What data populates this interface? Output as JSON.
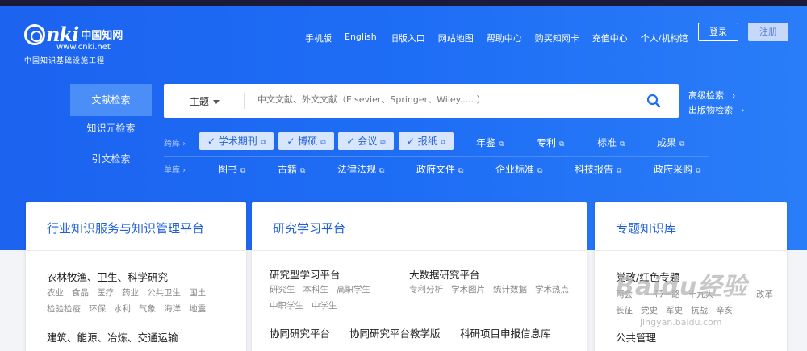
{
  "logo": {
    "nki": "nki",
    "cn": "中国知网",
    "url": "www.cnki.net",
    "subtitle": "中国知识基础设施工程"
  },
  "topnav": [
    "手机版",
    "English",
    "旧版入口",
    "网站地图",
    "帮助中心",
    "购买知网卡",
    "充值中心",
    "个人/机构馆"
  ],
  "auth": {
    "login": "登录",
    "register": "注册"
  },
  "sidetabs": [
    "文献检索",
    "知识元检索",
    "引文检索"
  ],
  "search": {
    "field": "主题",
    "placeholder": "中文文献、外文文献（Elsevier、Springer、Wiley......）"
  },
  "advanced": {
    "adv_search": "高级检索",
    "pub_search": "出版物检索"
  },
  "rows": {
    "kuaku": {
      "label": "跨库",
      "checked": [
        "学术期刊",
        "博硕",
        "会议",
        "报纸"
      ],
      "others": [
        "年鉴",
        "专利",
        "标准",
        "成果"
      ]
    },
    "danku": {
      "label": "单库",
      "items": [
        "图书",
        "古籍",
        "法律法规",
        "政府文件",
        "企业标准",
        "科技报告",
        "政府采购"
      ]
    }
  },
  "cards": {
    "industry": {
      "title": "行业知识服务与知识管理平台",
      "s1": {
        "head": "农林牧渔、卫生、科学研究",
        "line1": [
          "农业",
          "食品",
          "医疗",
          "药业",
          "公共卫生",
          "国土"
        ],
        "line2": [
          "检验检疫",
          "环保",
          "水利",
          "气象",
          "海洋",
          "地震"
        ]
      },
      "s2": {
        "head": "建筑、能源、冶炼、交通运输"
      }
    },
    "research": {
      "title": "研究学习平台",
      "a": {
        "head": "研究型学习平台",
        "items1": [
          "研究生",
          "本科生",
          "高职学生"
        ],
        "items2": [
          "中职学生",
          "中学生"
        ]
      },
      "b": {
        "head": "大数据研究平台",
        "items": [
          "专利分析",
          "学术图片",
          "统计数据",
          "学术热点"
        ]
      },
      "c": [
        "协同研究平台",
        "协同研究平台教学版",
        "科研项目申报信息库"
      ]
    },
    "topic": {
      "title": "专题知识库",
      "s1": {
        "head": "党政/红色专题",
        "line1": [
          "两会",
          "一带一路",
          "十九大"
        ],
        "line2": [
          "长征",
          "党史",
          "军史",
          "抗战",
          "辛亥"
        ],
        "extra": "改革"
      },
      "s2": {
        "head": "公共管理"
      }
    }
  },
  "watermark": {
    "main": "Baidu经验",
    "url": "jingyan.baidu.com"
  },
  "colors": {
    "hero": "#1e6df5",
    "accent": "#1f5fd8",
    "chip_bg": "#d8e6fd"
  }
}
